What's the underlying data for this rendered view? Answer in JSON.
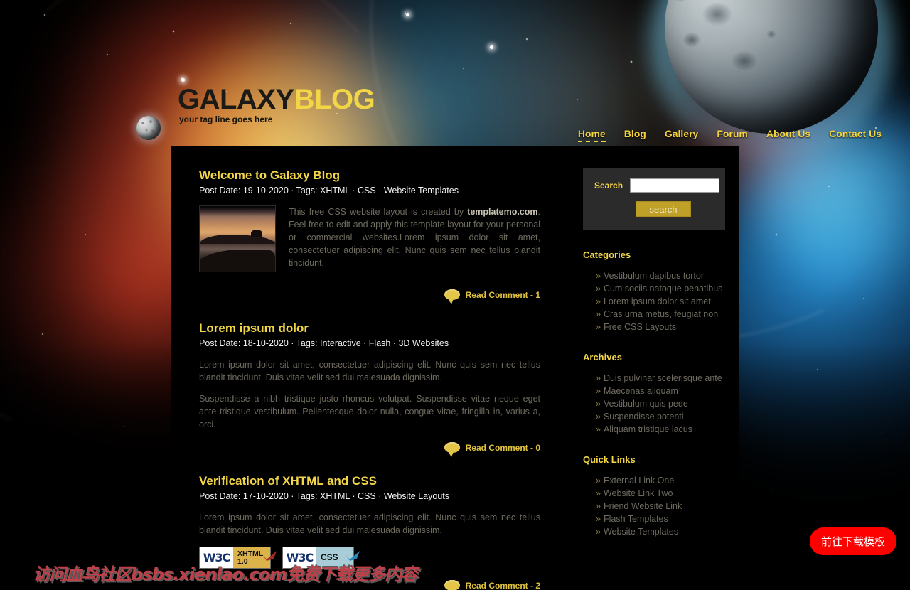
{
  "site": {
    "logo_primary": "GALAXY",
    "logo_secondary": "BLOG",
    "tagline": "your tag line goes here"
  },
  "nav": {
    "items": [
      {
        "label": "Home",
        "active": true
      },
      {
        "label": "Blog",
        "active": false
      },
      {
        "label": "Gallery",
        "active": false
      },
      {
        "label": "Forum",
        "active": false
      },
      {
        "label": "About Us",
        "active": false
      },
      {
        "label": "Contact Us",
        "active": false
      }
    ]
  },
  "posts": [
    {
      "title": "Welcome to Galaxy Blog",
      "meta": "Post Date: 19-10-2020 · Tags: XHTML · CSS · Website Templates",
      "has_thumb": true,
      "thumb_alt": "sunset-lake-photo",
      "body_lead": "This free CSS website layout is created by ",
      "body_link": "templatemo.com",
      "body_rest": ". Feel free to edit and apply this template layout for your personal or commercial websites.Lorem ipsum dolor sit amet, consectetuer adipiscing elit. Nunc quis sem nec tellus blandit tincidunt.",
      "body2": "",
      "comment_label": "Read Comment - 1"
    },
    {
      "title": "Lorem ipsum dolor",
      "meta": "Post Date: 18-10-2020 · Tags: Interactive · Flash · 3D Websites",
      "has_thumb": false,
      "body1": "Lorem ipsum dolor sit amet, consectetuer adipiscing elit. Nunc quis sem nec tellus blandit tincidunt. Duis vitae velit sed dui malesuada dignissim.",
      "body2": "Suspendisse a nibh tristique justo rhoncus volutpat. Suspendisse vitae neque eget ante tristique vestibulum. Pellentesque dolor nulla, congue vitae, fringilla in, varius a, orci.",
      "comment_label": "Read Comment - 0"
    },
    {
      "title": "Verification of XHTML and CSS",
      "meta": "Post Date: 17-10-2020 · Tags: XHTML · CSS · Website Layouts",
      "has_thumb": false,
      "body1": "Lorem ipsum dolor sit amet, consectetuer adipiscing elit. Nunc quis sem nec tellus blandit tincidunt. Duis vitae velit sed dui malesuada dignissim.",
      "comment_label": "Read Comment - 2"
    }
  ],
  "badges": {
    "xhtml": {
      "org": "W3C",
      "line1": "XHTML",
      "line2": "1.0",
      "tick_color": "#a32c22"
    },
    "css": {
      "org": "W3C",
      "line1": "CSS",
      "tick_color": "#2a84b8"
    }
  },
  "sidebar": {
    "search": {
      "label": "Search",
      "value": "",
      "placeholder": "",
      "button_label": "search"
    },
    "sections": [
      {
        "heading": "Categories",
        "items": [
          "Vestibulum dapibus tortor",
          "Cum sociis natoque penatibus",
          "Lorem ipsum dolor sit amet",
          "Cras urna metus, feugiat non",
          "Free CSS Layouts"
        ]
      },
      {
        "heading": "Archives",
        "items": [
          "Duis pulvinar scelerisque ante",
          "Maecenas aliquam",
          "Vestibulum quis pede",
          "Suspendisse potenti",
          "Aliquam tristique lacus"
        ]
      },
      {
        "heading": "Quick Links",
        "items": [
          "External Link One",
          "Website Link Two",
          "Friend Website Link",
          "Flash Templates",
          "Website Templates"
        ]
      }
    ],
    "bullet": "»"
  },
  "overlay": {
    "watermark": "访问血鸟社区bsbs.xienlao.com免费下载更多内容",
    "download_button": "前往下载模板"
  },
  "colors": {
    "accent_gold": "#f2d648",
    "body_text": "#6e6a5e",
    "panel_bg": "#000000",
    "search_bg": "#2b2b2b",
    "button_bg": "#c0a127",
    "download_red": "#fe0000"
  }
}
